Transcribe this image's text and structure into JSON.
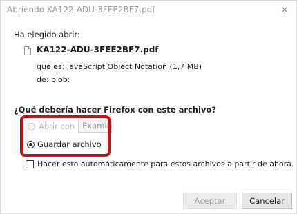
{
  "window": {
    "title": "Abriendo KA122-ADU-3FEE2BF7.pdf",
    "close_icon": "close-icon"
  },
  "dialog": {
    "intro": "Ha elegido abrir:",
    "file_icon": "document-icon",
    "file_name": "KA122-ADU-3FEE2BF7.pdf",
    "type_line": "que es: JavaScript Object Notation (1,7 MB)",
    "from_line": "de: blob:",
    "question": "¿Qué debería hacer Firefox con este archivo?"
  },
  "options": {
    "open_with_label": "Abrir con",
    "open_with_selected": "Examinar...",
    "open_with_checked": false,
    "save_label": "Guardar archivo",
    "save_checked": true
  },
  "auto_checkbox": {
    "label": "Hacer esto automáticamente para estos archivos a partir de ahora.",
    "checked": false
  },
  "buttons": {
    "accept": "Aceptar",
    "cancel": "Cancelar"
  },
  "colors": {
    "highlight": "#c0141a",
    "disabled_text": "#a0a0a0"
  }
}
